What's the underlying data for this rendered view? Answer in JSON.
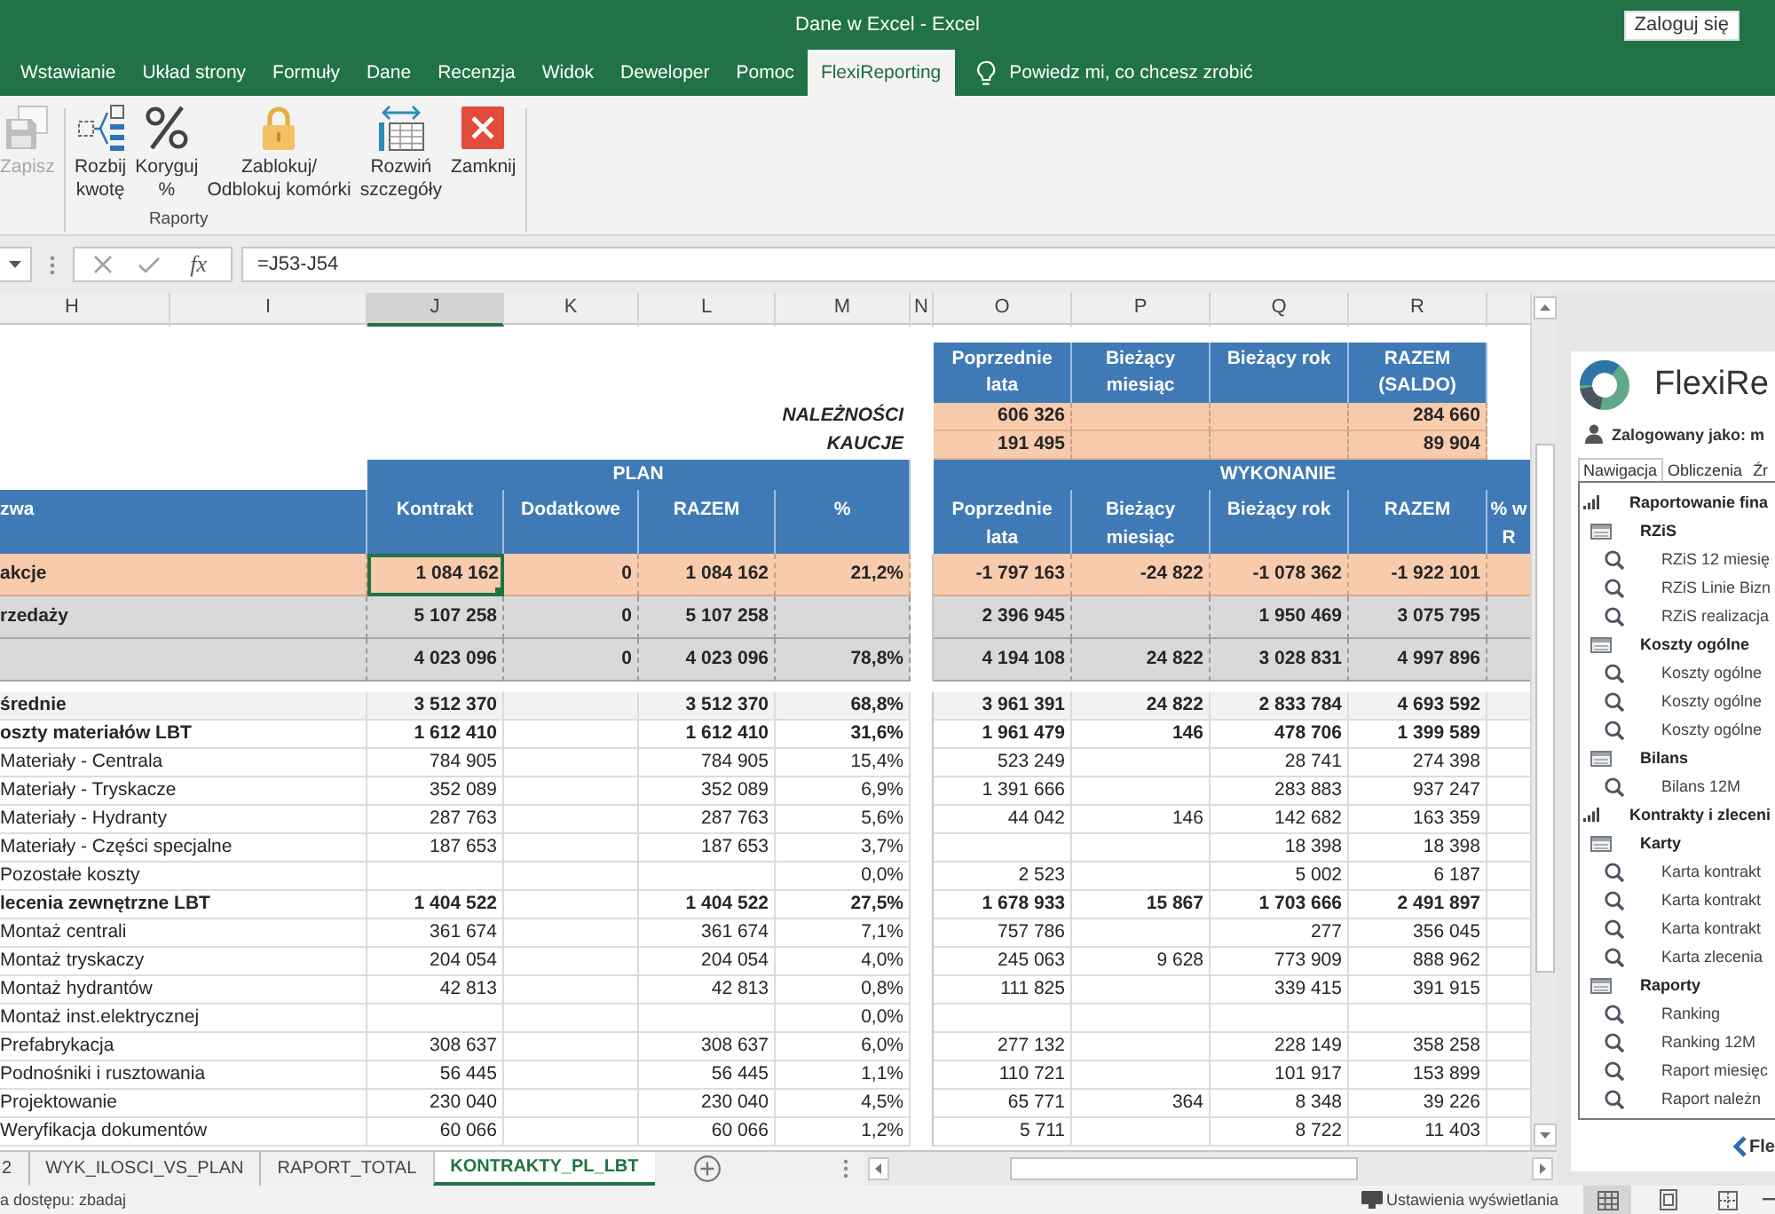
{
  "window": {
    "title": "Dane w Excel - Excel",
    "sign_in_button": "Zaloguj się"
  },
  "ribbon_tabs": [
    {
      "label": "Wstawianie",
      "selected": false
    },
    {
      "label": "Układ strony",
      "selected": false
    },
    {
      "label": "Formuły",
      "selected": false
    },
    {
      "label": "Dane",
      "selected": false
    },
    {
      "label": "Recenzja",
      "selected": false
    },
    {
      "label": "Widok",
      "selected": false
    },
    {
      "label": "Deweloper",
      "selected": false
    },
    {
      "label": "Pomoc",
      "selected": false
    },
    {
      "label": "FlexiReporting",
      "selected": true
    }
  ],
  "tell_me": {
    "placeholder": "Powiedz mi, co chcesz zrobić"
  },
  "ribbon": {
    "groups": [
      {
        "buttons": [
          {
            "label": "Zapisz",
            "disabled": true
          }
        ]
      },
      {
        "label": "Raporty",
        "buttons": [
          {
            "label": "Rozbij\nkwotę",
            "disabled": false
          },
          {
            "label": "Koryguj\n%",
            "disabled": false
          },
          {
            "label": "Zablokuj/\nOdblokuj komórki",
            "disabled": false
          },
          {
            "label": "Rozwiń\nszczegóły",
            "disabled": false
          },
          {
            "label": "Zamknij",
            "disabled": false
          }
        ]
      }
    ]
  },
  "formula_bar": {
    "function_button": "fx",
    "formula": "=J53-J54"
  },
  "columns": [
    {
      "label": "H",
      "selected": false
    },
    {
      "label": "I",
      "selected": false
    },
    {
      "label": "J",
      "selected": true
    },
    {
      "label": "K",
      "selected": false
    },
    {
      "label": "L",
      "selected": false
    },
    {
      "label": "M",
      "selected": false
    },
    {
      "label": "N",
      "selected": false
    },
    {
      "label": "O",
      "selected": false
    },
    {
      "label": "P",
      "selected": false
    },
    {
      "label": "Q",
      "selected": false
    },
    {
      "label": "R",
      "selected": false
    }
  ],
  "sheet": {
    "summary": {
      "columns": [
        "Poprzednie lata",
        "Bieżący miesiąc",
        "Bieżący rok",
        "RAZEM (SALDO)"
      ],
      "rows": [
        {
          "label": "NALEŻNOŚCI",
          "values": {
            "previous_years": "606 326",
            "total": "284 660"
          }
        },
        {
          "label": "KAUCJE",
          "values": {
            "previous_years": "191 495",
            "total": "89 904"
          }
        }
      ]
    },
    "plan_title": "PLAN",
    "execution_title": "WYKONANIE",
    "name_header": "zwa",
    "plan_columns": [
      "Kontrakt",
      "Dodatkowe",
      "RAZEM",
      "%"
    ],
    "execution_columns": [
      "Poprzednie lata",
      "Bieżący miesiąc",
      "Bieżący rok",
      "RAZEM",
      "% w\nR"
    ],
    "rows": [
      {
        "label": "akcje",
        "kind": "accent",
        "selected": true,
        "plan": {
          "contract": "1 084 162",
          "additional": "0",
          "total": "1 084 162",
          "share": "21,2%"
        },
        "execution": {
          "previous_years": "-1 797 163",
          "current_month": "-24 822",
          "current_year": "-1 078 362",
          "total": "-1 922 101"
        }
      },
      {
        "label": "rzedaży",
        "kind": "total",
        "selected": false,
        "plan": {
          "contract": "5 107 258",
          "additional": "0",
          "total": "5 107 258"
        },
        "execution": {
          "previous_years": "2 396 945",
          "current_year": "1 950 469",
          "total": "3 075 795"
        }
      },
      {
        "kind": "total",
        "selected": false,
        "plan": {
          "contract": "4 023 096",
          "additional": "0",
          "total": "4 023 096",
          "share": "78,8%"
        },
        "execution": {
          "previous_years": "4 194 108",
          "current_month": "24 822",
          "current_year": "3 028 831",
          "total": "4 997 896"
        }
      },
      {
        "label": "średnie",
        "kind": "subtotal",
        "selected": false,
        "plan": {
          "contract": "3 512 370",
          "total": "3 512 370",
          "share": "68,8%"
        },
        "execution": {
          "previous_years": "3 961 391",
          "current_month": "24 822",
          "current_year": "2 833 784",
          "total": "4 693 592"
        }
      },
      {
        "label": "oszty materiałów LBT",
        "kind": "group",
        "selected": false,
        "plan": {
          "contract": "1 612 410",
          "total": "1 612 410",
          "share": "31,6%"
        },
        "execution": {
          "previous_years": "1 961 479",
          "current_month": "146",
          "current_year": "478 706",
          "total": "1 399 589"
        }
      },
      {
        "label": "Materiały - Centrala",
        "kind": "item",
        "selected": false,
        "plan": {
          "contract": "784 905",
          "total": "784 905",
          "share": "15,4%"
        },
        "execution": {
          "previous_years": "523 249",
          "current_year": "28 741",
          "total": "274 398"
        }
      },
      {
        "label": "Materiały - Tryskacze",
        "kind": "item",
        "selected": false,
        "plan": {
          "contract": "352 089",
          "total": "352 089",
          "share": "6,9%"
        },
        "execution": {
          "previous_years": "1 391 666",
          "current_year": "283 883",
          "total": "937 247"
        }
      },
      {
        "label": "Materiały - Hydranty",
        "kind": "item",
        "selected": false,
        "plan": {
          "contract": "287 763",
          "total": "287 763",
          "share": "5,6%"
        },
        "execution": {
          "previous_years": "44 042",
          "current_month": "146",
          "current_year": "142 682",
          "total": "163 359"
        }
      },
      {
        "label": "Materiały - Części specjalne",
        "kind": "item",
        "selected": false,
        "plan": {
          "contract": "187 653",
          "total": "187 653",
          "share": "3,7%"
        },
        "execution": {
          "current_year": "18 398",
          "total": "18 398"
        }
      },
      {
        "label": "Pozostałe koszty",
        "kind": "item",
        "selected": false,
        "plan": {
          "share": "0,0%"
        },
        "execution": {
          "previous_years": "2 523",
          "current_year": "5 002",
          "total": "6 187"
        }
      },
      {
        "label": "lecenia zewnętrzne LBT",
        "kind": "group",
        "selected": false,
        "plan": {
          "contract": "1 404 522",
          "total": "1 404 522",
          "share": "27,5%"
        },
        "execution": {
          "previous_years": "1 678 933",
          "current_month": "15 867",
          "current_year": "1 703 666",
          "total": "2 491 897"
        }
      },
      {
        "label": "Montaż centrali",
        "kind": "item",
        "selected": false,
        "plan": {
          "contract": "361 674",
          "total": "361 674",
          "share": "7,1%"
        },
        "execution": {
          "previous_years": "757 786",
          "current_year": "277",
          "total": "356 045"
        }
      },
      {
        "label": "Montaż tryskaczy",
        "kind": "item",
        "selected": false,
        "plan": {
          "contract": "204 054",
          "total": "204 054",
          "share": "4,0%"
        },
        "execution": {
          "previous_years": "245 063",
          "current_month": "9 628",
          "current_year": "773 909",
          "total": "888 962"
        }
      },
      {
        "label": "Montaż hydrantów",
        "kind": "item",
        "selected": false,
        "plan": {
          "contract": "42 813",
          "total": "42 813",
          "share": "0,8%"
        },
        "execution": {
          "previous_years": "111 825",
          "current_year": "339 415",
          "total": "391 915"
        }
      },
      {
        "label": "Montaż inst.elektrycznej",
        "kind": "item",
        "selected": false,
        "plan": {
          "share": "0,0%"
        }
      },
      {
        "label": "Prefabrykacja",
        "kind": "item",
        "selected": false,
        "plan": {
          "contract": "308 637",
          "total": "308 637",
          "share": "6,0%"
        },
        "execution": {
          "previous_years": "277 132",
          "current_year": "228 149",
          "total": "358 258"
        }
      },
      {
        "label": "Podnośniki i rusztowania",
        "kind": "item",
        "selected": false,
        "plan": {
          "contract": "56 445",
          "total": "56 445",
          "share": "1,1%"
        },
        "execution": {
          "previous_years": "110 721",
          "current_year": "101 917",
          "total": "153 899"
        }
      },
      {
        "label": "Projektowanie",
        "kind": "item",
        "selected": false,
        "plan": {
          "contract": "230 040",
          "total": "230 040",
          "share": "4,5%"
        },
        "execution": {
          "previous_years": "65 771",
          "current_month": "364",
          "current_year": "8 348",
          "total": "39 226"
        }
      },
      {
        "label": "Weryfikacja dokumentów",
        "kind": "item",
        "selected": false,
        "plan": {
          "contract": "60 066",
          "total": "60 066",
          "share": "1,2%"
        },
        "execution": {
          "previous_years": "5 711",
          "current_year": "8 722",
          "total": "11 403"
        }
      }
    ]
  },
  "sheet_tabs": [
    {
      "label": "2",
      "selected": false
    },
    {
      "label": "WYK_ILOSCI_VS_PLAN",
      "selected": false
    },
    {
      "label": "RAPORT_TOTAL",
      "selected": false
    },
    {
      "label": "KONTRAKTY_PL_LBT",
      "selected": true
    }
  ],
  "panel": {
    "title": "FlexiRe",
    "user": "Zalogowany jako: m",
    "tabs": [
      {
        "label": "Nawigacja",
        "selected": true
      },
      {
        "label": "Obliczenia",
        "selected": false
      },
      {
        "label": "Źr",
        "selected": false
      }
    ],
    "tree": [
      {
        "label": "Raportowanie fina",
        "children": [
          {
            "label": "RZiS",
            "children": [
              {
                "label": "RZiS 12 miesię"
              },
              {
                "label": "RZiS Linie Bizn"
              },
              {
                "label": "RZiS realizacja"
              }
            ]
          },
          {
            "label": "Koszty ogólne",
            "children": [
              {
                "label": "Koszty ogólne"
              },
              {
                "label": "Koszty ogólne"
              },
              {
                "label": "Koszty ogólne"
              }
            ]
          },
          {
            "label": "Bilans",
            "children": [
              {
                "label": "Bilans 12M"
              }
            ]
          }
        ]
      },
      {
        "label": "Kontrakty i zleceni",
        "children": [
          {
            "label": "Karty",
            "children": [
              {
                "label": "Karta kontrakt"
              },
              {
                "label": "Karta kontrakt"
              },
              {
                "label": "Karta kontrakt"
              },
              {
                "label": "Karta zlecenia"
              }
            ]
          },
          {
            "label": "Raporty",
            "children": [
              {
                "label": "Ranking"
              },
              {
                "label": "Ranking 12M"
              },
              {
                "label": "Raport miesięc"
              },
              {
                "label": "Raport należn"
              }
            ]
          }
        ]
      }
    ],
    "footer_logo": "Fle"
  },
  "status_bar": {
    "accessibility": "a dostępu: zbadaj",
    "display_settings": "Ustawienia wyświetlania",
    "views": [
      {
        "selected": true
      },
      {
        "selected": false
      },
      {
        "selected": false
      }
    ]
  }
}
